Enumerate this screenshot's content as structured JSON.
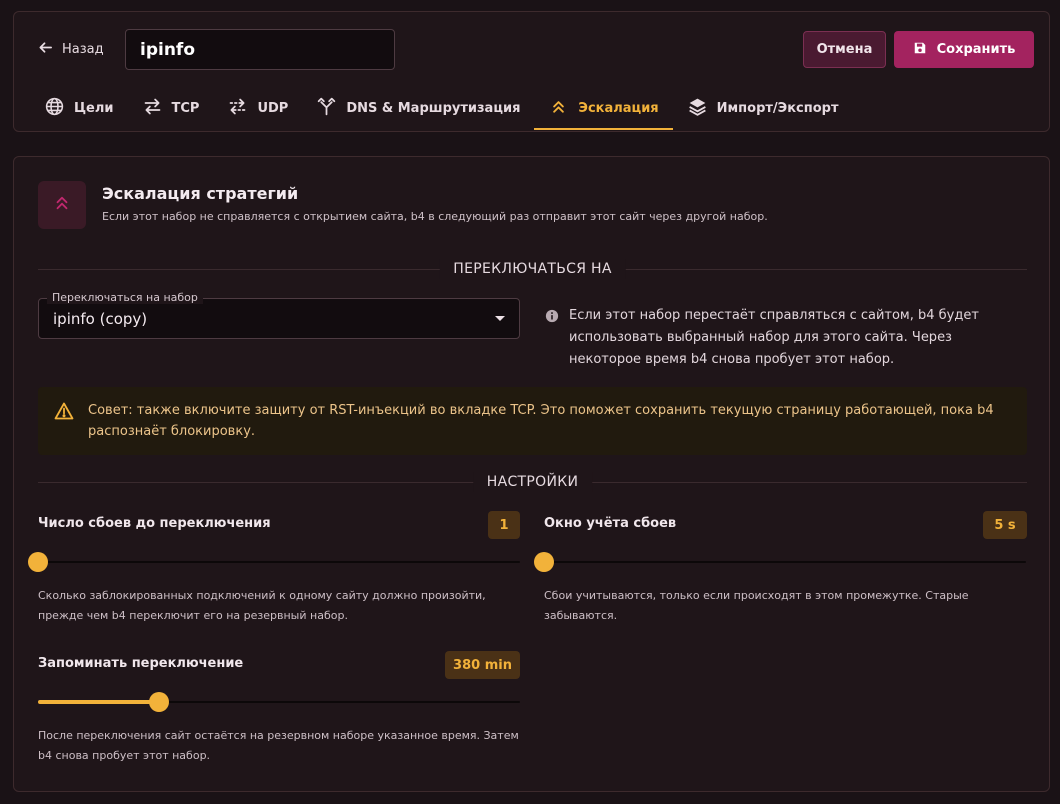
{
  "header": {
    "back_label": "Назад",
    "set_name": "ipinfo",
    "cancel_label": "Отмена",
    "save_label": "Сохранить"
  },
  "tabs": [
    {
      "label": "Цели",
      "icon": "globe-icon"
    },
    {
      "label": "TCP",
      "icon": "swap-arrows-icon"
    },
    {
      "label": "UDP",
      "icon": "dashed-swap-icon"
    },
    {
      "label": "DNS & Маршрутизация",
      "icon": "fork-icon"
    },
    {
      "label": "Эскалация",
      "icon": "double-chevron-up-icon",
      "active": true
    },
    {
      "label": "Импорт/Экспорт",
      "icon": "layers-icon"
    }
  ],
  "section": {
    "title": "Эскалация стратегий",
    "description": "Если этот набор не справляется с открытием сайта, b4 в следующий раз отправит этот сайт через другой набор."
  },
  "switch_section": {
    "divider": "ПЕРЕКЛЮЧАТЬСЯ НА",
    "select_label": "Переключаться на набор",
    "select_value": "ipinfo (copy)",
    "info": "Если этот набор перестаёт справляться с сайтом, b4 будет использовать выбранный набор для этого сайта. Через некоторое время b4 снова пробует этот набор."
  },
  "tip": {
    "text": "Совет: также включите защиту от RST-инъекций во вкладке TCP. Это поможет сохранить текущую страницу работающей, пока b4 распознаёт блокировку."
  },
  "settings": {
    "divider": "НАСТРОЙКИ",
    "failures": {
      "label": "Число сбоев до переключения",
      "value": "1",
      "fraction": 0,
      "help": "Сколько заблокированных подключений к одному сайту должно произойти, прежде чем b4 переключит его на резервный набор."
    },
    "window": {
      "label": "Окно учёта сбоев",
      "value": "5 s",
      "fraction": 0,
      "help": "Сбои учитываются, только если происходят в этом промежутке. Старые забываются."
    },
    "remember": {
      "label": "Запоминать переключение",
      "value": "380 min",
      "fraction": 0.25,
      "help": "После переключения сайт остаётся на резервном наборе указанное время. Затем b4 снова пробует этот набор."
    }
  },
  "colors": {
    "accent": "#f2b23a",
    "primary": "#a3235f",
    "background": "#1a1216",
    "warning_text": "#ecc48a"
  }
}
